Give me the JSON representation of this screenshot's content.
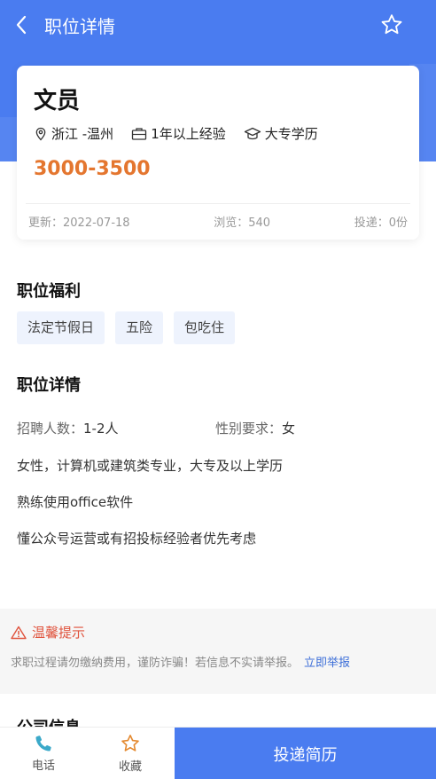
{
  "header": {
    "title": "职位详情",
    "back_icon": "chevron-left-icon",
    "favorite_icon": "star-outline-icon",
    "accent_color": "#4a7cf0"
  },
  "job": {
    "title": "文员",
    "location": "浙江 -温州",
    "experience": "1年以上经验",
    "education": "大专学历",
    "salary": "3000-3500",
    "salary_color": "#e4762f",
    "updated_label": "更新：",
    "updated": "2022-07-18",
    "views_label": "浏览：",
    "views": "540",
    "applies_label": "投递：",
    "applies": "0份"
  },
  "benefits": {
    "title": "职位福利",
    "tags": [
      "法定节假日",
      "五险",
      "包吃住"
    ]
  },
  "details": {
    "title": "职位详情",
    "headcount_label": "招聘人数：",
    "headcount": "1-2人",
    "gender_label": "性别要求：",
    "gender": "女",
    "lines": [
      "女性，计算机或建筑类专业，大专及以上学历",
      "熟练使用office软件",
      "懂公众号运营或有招投标经验者优先考虑"
    ]
  },
  "notice": {
    "title": "温馨提示",
    "text": "求职过程请勿缴纳费用，谨防诈骗！若信息不实请举报。",
    "link": "立即举报",
    "warning_color": "#e0533d"
  },
  "company": {
    "title": "公司信息"
  },
  "bottom_bar": {
    "phone_label": "电话",
    "phone_icon": "phone-icon",
    "favorite_label": "收藏",
    "favorite_icon": "star-icon",
    "apply_label": "投递简历"
  }
}
